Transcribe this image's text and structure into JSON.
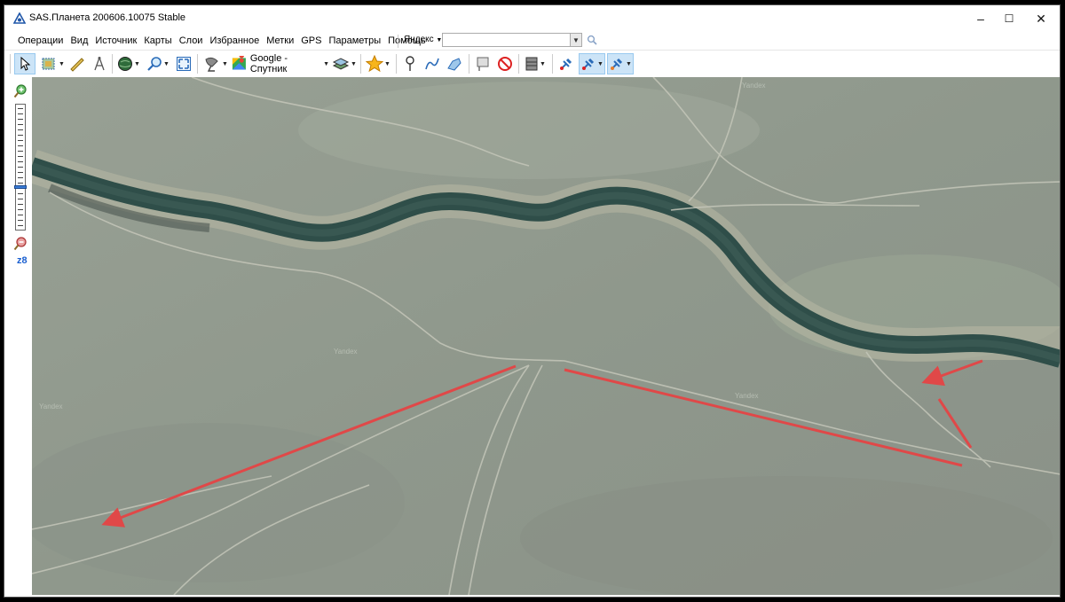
{
  "window": {
    "title": "SAS.Планета 200606.10075 Stable",
    "minimize": "–",
    "maximize": "☐",
    "close": "✕"
  },
  "menu": [
    {
      "label": "Операции"
    },
    {
      "label": "Вид"
    },
    {
      "label": "Источник"
    },
    {
      "label": "Карты"
    },
    {
      "label": "Слои"
    },
    {
      "label": "Избранное"
    },
    {
      "label": "Метки"
    },
    {
      "label": "GPS"
    },
    {
      "label": "Параметры"
    },
    {
      "label": "Помощь"
    }
  ],
  "search": {
    "provider": "Яндекс",
    "value": ""
  },
  "toolbar": {
    "map_source": "Google - Спутник"
  },
  "zoom": {
    "level_label": "z8"
  },
  "map": {
    "watermarks": [
      "Yandex",
      "Yandex",
      "Yandex",
      "Yandex"
    ]
  },
  "colors": {
    "accent": "#1a5fd0",
    "arrow": "#e04848",
    "river": "#2f4e49"
  }
}
